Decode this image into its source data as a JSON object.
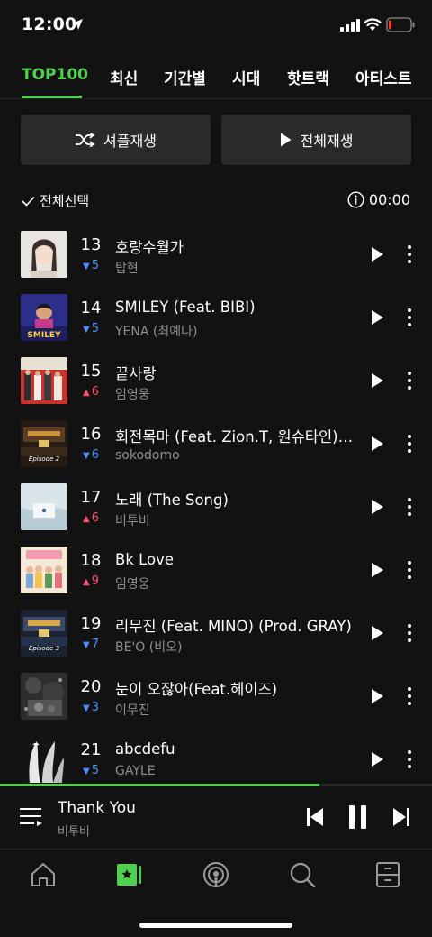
{
  "status_bar": {
    "time": "12:00"
  },
  "tabs": [
    {
      "label": "TOP100",
      "active": true
    },
    {
      "label": "최신",
      "active": false
    },
    {
      "label": "기간별",
      "active": false
    },
    {
      "label": "시대",
      "active": false
    },
    {
      "label": "핫트랙",
      "active": false
    },
    {
      "label": "아티스트",
      "active": false
    }
  ],
  "actions": {
    "shuffle_label": "셔플재생",
    "play_all_label": "전체재생"
  },
  "select_all_label": "전체선택",
  "total_duration": "00:00",
  "songs": [
    {
      "rank": "13",
      "direction": "down",
      "change": "5",
      "title": "호랑수월가",
      "artist": "탑현"
    },
    {
      "rank": "14",
      "direction": "down",
      "change": "5",
      "title": "SMILEY (Feat. BIBI)",
      "artist": "YENA (최예나)"
    },
    {
      "rank": "15",
      "direction": "up",
      "change": "6",
      "title": "끝사랑",
      "artist": "임영웅"
    },
    {
      "rank": "16",
      "direction": "down",
      "change": "6",
      "title": "회전목마 (Feat. Zion.T, 원슈타인) (Prod. Slom)",
      "artist": "sokodomo"
    },
    {
      "rank": "17",
      "direction": "up",
      "change": "6",
      "title": "노래 (The Song)",
      "artist": "비투비"
    },
    {
      "rank": "18",
      "direction": "up",
      "change": "9",
      "title": "Bk Love",
      "artist": "임영웅"
    },
    {
      "rank": "19",
      "direction": "down",
      "change": "7",
      "title": "리무진 (Feat. MINO) (Prod. GRAY)",
      "artist": "BE'O (비오)"
    },
    {
      "rank": "20",
      "direction": "down",
      "change": "3",
      "title": "눈이 오잖아(Feat.헤이즈)",
      "artist": "이무진"
    },
    {
      "rank": "21",
      "direction": "down",
      "change": "5",
      "title": "abcdefu",
      "artist": "GAYLE"
    }
  ],
  "cover_art_text": {
    "smiley": "SMILEY",
    "episode_2": "Episode 2",
    "episode_3": "Episode 3"
  },
  "now_playing": {
    "title": "Thank You",
    "artist": "비투비",
    "progress": 0.74
  },
  "bottom_nav": [
    {
      "icon": "home-icon",
      "active": false
    },
    {
      "icon": "library-icon",
      "active": true
    },
    {
      "icon": "podcast-icon",
      "active": false
    },
    {
      "icon": "search-icon",
      "active": false
    },
    {
      "icon": "storage-icon",
      "active": false
    }
  ],
  "colors": {
    "accent": "#4fd14d",
    "background": "#121212",
    "up": "#ff4e6e",
    "down": "#4a90ff"
  }
}
